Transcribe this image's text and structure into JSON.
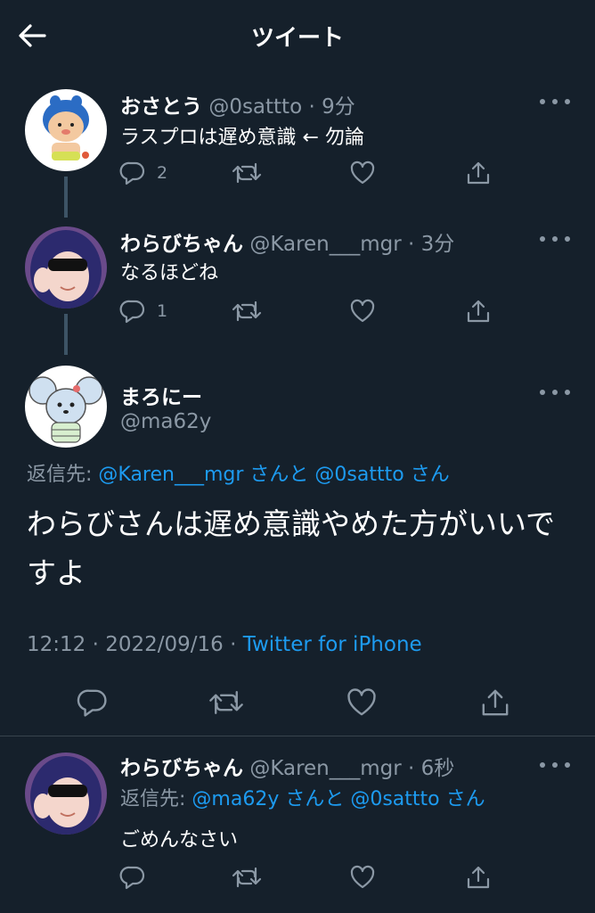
{
  "header": {
    "title": "ツイート",
    "back_icon": "arrow-left-icon"
  },
  "tweets": [
    {
      "name": "おさとう",
      "handle": "@0sattto",
      "time": "· 9分",
      "text": "ラスプロは遅め意識 ← 勿論",
      "reply_count": "2"
    },
    {
      "name": "わらびちゃん",
      "handle": "@Karen___mgr",
      "time": "· 3分",
      "text": "なるほどね",
      "reply_count": "1"
    }
  ],
  "main_tweet": {
    "name": "まろにー",
    "handle": "@ma62y",
    "reply_prefix": "返信先: ",
    "reply_mention_1": "@Karen___mgr",
    "reply_mid": " さんと ",
    "reply_mention_2": "@0sattto",
    "reply_suffix": " さん",
    "text": "わらびさんは遅め意識やめた方がいいですよ",
    "timestamp": "12:12 · 2022/09/16 · ",
    "client": "Twitter for iPhone"
  },
  "reply_tweet": {
    "name": "わらびちゃん",
    "handle": "@Karen___mgr",
    "time": "· 6秒",
    "reply_prefix": "返信先: ",
    "reply_mention_1": "@ma62y",
    "reply_mid": " さんと ",
    "reply_mention_2": "@0sattto",
    "reply_suffix": " さん",
    "text": "ごめんなさい"
  },
  "colors": {
    "background": "#15202b",
    "text": "#ffffff",
    "muted": "#8b98a5",
    "accent": "#1d9bf0",
    "divider": "#38444d"
  }
}
